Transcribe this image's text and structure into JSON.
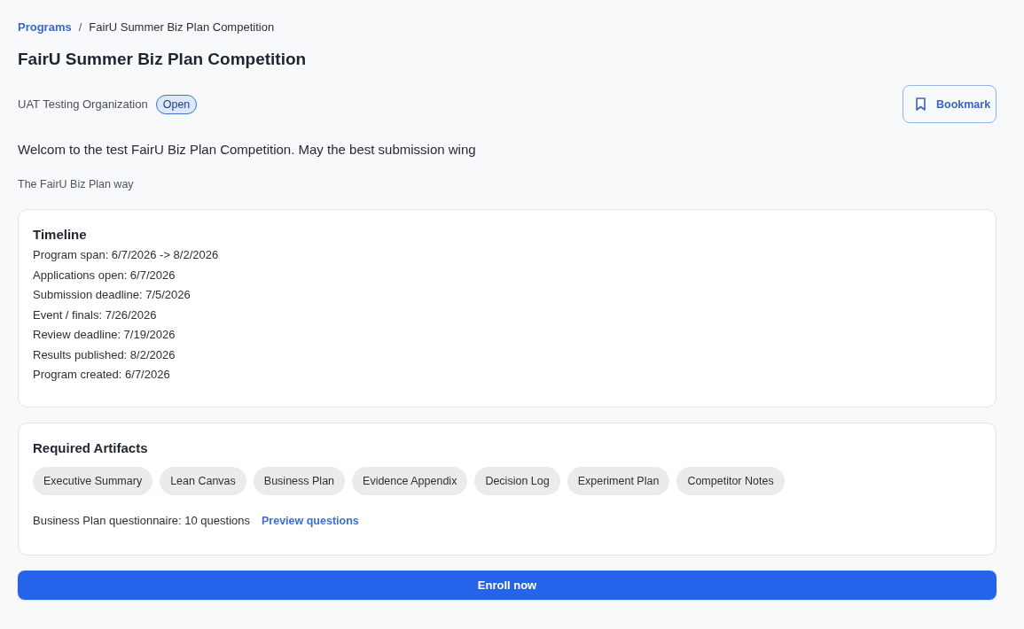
{
  "breadcrumb": {
    "items": [
      {
        "label": "Programs",
        "kind": "link"
      },
      {
        "label": "FairU Summer Biz Plan Competition",
        "kind": "current"
      }
    ],
    "separator": "/"
  },
  "title": "FairU Summer Biz Plan Competition",
  "organization": "UAT Testing Organization",
  "status_badge": "Open",
  "bookmark_button": {
    "label": "Bookmark",
    "bookmarked": false
  },
  "description": "Welcom to the test FairU Biz Plan Competition. May the best submission wing",
  "tagline": "The FairU Biz Plan way",
  "timeline": {
    "heading": "Timeline",
    "lines": [
      "Program span: 6/7/2026 -> 8/2/2026",
      "Applications open: 6/7/2026",
      "Submission deadline: 7/5/2026",
      "Event / finals: 7/26/2026",
      "Review deadline: 7/19/2026",
      "Results published: 8/2/2026",
      "Program created: 6/7/2026"
    ]
  },
  "required_artifacts": {
    "heading": "Required Artifacts",
    "chips": [
      "Executive Summary",
      "Lean Canvas",
      "Business Plan",
      "Evidence Appendix",
      "Decision Log",
      "Experiment Plan",
      "Competitor Notes"
    ],
    "questionnaire": "Business Plan questionnaire: 10 questions",
    "preview_link": "Preview questions"
  },
  "enroll_button": "Enroll now"
}
